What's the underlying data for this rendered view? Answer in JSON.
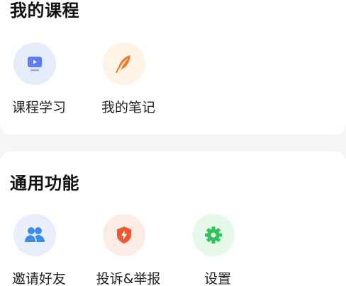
{
  "my_courses": {
    "title": "我的课程",
    "items": [
      {
        "label": "课程学习",
        "icon": "video-lesson-icon",
        "bg": "#e7ecfb",
        "color": "#5d7cf0"
      },
      {
        "label": "我的笔记",
        "icon": "quill-feather-icon",
        "bg": "#fff3e6",
        "color": "#f37a2a"
      }
    ]
  },
  "general_functions": {
    "title": "通用功能",
    "items": [
      {
        "label": "邀请好友",
        "icon": "users-icon",
        "bg": "#e8effb",
        "color": "#3d8bea"
      },
      {
        "label": "投诉&举报",
        "icon": "shield-lightning-icon",
        "bg": "#fdece6",
        "color": "#f0562f"
      },
      {
        "label": "设置",
        "icon": "gear-icon",
        "bg": "#e6f8e9",
        "color": "#2fc25b"
      }
    ]
  }
}
